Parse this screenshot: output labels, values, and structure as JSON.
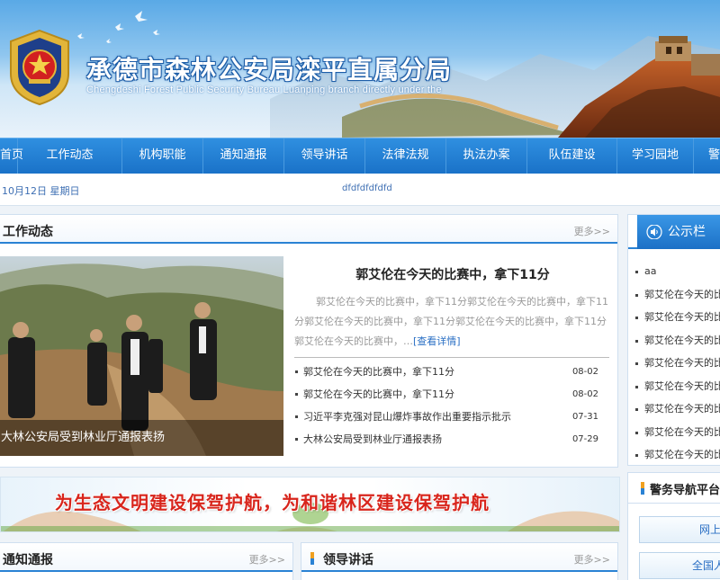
{
  "header": {
    "title": "承德市森林公安局滦平直属分局",
    "subtitle": "Chengdeshi Forest Public Security Bureau Luanping branch directly under the"
  },
  "nav": {
    "items": [
      "首页",
      "工作动态",
      "机构职能",
      "通知通报",
      "领导讲话",
      "法律法规",
      "执法办案",
      "队伍建设",
      "学习园地",
      "警"
    ]
  },
  "datebar": {
    "date": "10月12日  星期日",
    "marquee": "dfdfdfdfdfd"
  },
  "work_news": {
    "title": "工作动态",
    "more": "更多>>",
    "photo_caption": "大林公安局受到林业厅通报表扬",
    "headline": "郭艾伦在今天的比赛中，拿下11分",
    "summary": "郭艾伦在今天的比赛中，拿下11分郭艾伦在今天的比赛中，拿下11分郭艾伦在今天的比赛中，拿下11分郭艾伦在今天的比赛中，拿下11分郭艾伦在今天的比赛中，…",
    "detail_link": "[查看详情]",
    "items": [
      {
        "text": "郭艾伦在今天的比赛中，拿下11分",
        "date": "08-02"
      },
      {
        "text": "郭艾伦在今天的比赛中，拿下11分",
        "date": "08-02"
      },
      {
        "text": "习近平李克强对昆山爆炸事故作出重要指示批示",
        "date": "07-31"
      },
      {
        "text": "大林公安局受到林业厅通报表扬",
        "date": "07-29"
      }
    ]
  },
  "banner": {
    "slogan": "为生态文明建设保驾护航，为和谐林区建设保驾护航"
  },
  "notice": {
    "title": "通知通报",
    "more": "更多>>"
  },
  "leader": {
    "title": "领导讲话",
    "more": "更多>>"
  },
  "board": {
    "title": "公示栏",
    "items": [
      "aa",
      "郭艾伦在今天的比赛",
      "郭艾伦在今天的比赛",
      "郭艾伦在今天的比赛",
      "郭艾伦在今天的比赛",
      "郭艾伦在今天的比赛",
      "郭艾伦在今天的比赛",
      "郭艾伦在今天的比赛",
      "郭艾伦在今天的比赛"
    ]
  },
  "police_nav": {
    "title": "警务导航平台",
    "buttons": [
      "网上",
      "全国人"
    ]
  }
}
